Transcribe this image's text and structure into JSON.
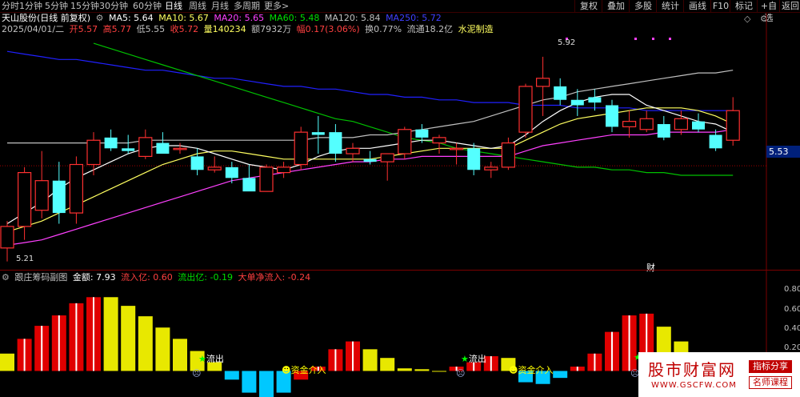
{
  "topbar": {
    "timeframes": [
      {
        "label": "分时",
        "name": "tab-intraday",
        "active": false
      },
      {
        "label": "1分钟",
        "name": "tab-1min",
        "active": false
      },
      {
        "label": "5分钟",
        "name": "tab-5min",
        "active": false
      },
      {
        "label": "15分钟",
        "name": "tab-15min",
        "active": false
      },
      {
        "label": "30分钟",
        "name": "tab-30min",
        "active": false
      },
      {
        "label": "60分钟",
        "name": "tab-60min",
        "active": false
      },
      {
        "label": "日线",
        "name": "tab-daily",
        "active": true
      },
      {
        "label": "周线",
        "name": "tab-weekly",
        "active": false
      },
      {
        "label": "月线",
        "name": "tab-monthly",
        "active": false
      },
      {
        "label": "多周期",
        "name": "tab-multi-period",
        "active": false
      },
      {
        "label": "更多>",
        "name": "tab-more",
        "active": false
      }
    ],
    "right_buttons": [
      {
        "label": "复权",
        "name": "adjust-button"
      },
      {
        "label": "叠加",
        "name": "overlay-button"
      },
      {
        "label": "多股",
        "name": "multi-stock-button"
      },
      {
        "label": "统计",
        "name": "statistics-button"
      },
      {
        "label": "画线",
        "name": "draw-line-button"
      },
      {
        "label": "F10",
        "name": "f10-button"
      },
      {
        "label": "标记",
        "name": "mark-button"
      },
      {
        "label": "+自选",
        "name": "add-watchlist-button"
      },
      {
        "label": "返回",
        "name": "back-button"
      }
    ]
  },
  "stock": {
    "title": "天山股份(日线 前复权)",
    "ma5": "MA5: 5.64",
    "ma10": "MA10: 5.67",
    "ma20": "MA20: 5.65",
    "ma60": "MA60: 5.48",
    "ma120": "MA120: 5.84",
    "ma250": "MA250: 5.72",
    "date": "2025/04/01/二",
    "open": "开5.57",
    "high": "高5.77",
    "low": "低5.55",
    "close": "收5.72",
    "volume": "量140234",
    "amount": "额7932万",
    "change": "幅0.17(3.06%)",
    "turnover": "换0.77%",
    "float_cap": "流通18.2亿",
    "sector": "水泥制造"
  },
  "price_labels": {
    "high_mark": "5.92",
    "low_mark": "5.21",
    "current": "5.53",
    "finance_marker": "财"
  },
  "indicator": {
    "name": "跟庄筹码副图",
    "amount": "金额: 7.93",
    "inflow": "流入亿: 0.60",
    "outflow": "流出亿: -0.19",
    "big_order": "大单净流入: -0.24",
    "axis": [
      "0.80",
      "0.60",
      "0.40",
      "0.20"
    ],
    "labels": {
      "fund_out": "流出",
      "fund_in": "资金介入"
    }
  },
  "watermark": {
    "site": "股市财富网",
    "url": "WWW.GSCFW.COM",
    "tag1": "指标分享",
    "tag2": "名师课程"
  },
  "colors": {
    "up": "#ff3030",
    "down": "#54ffff",
    "ma5": "#ffffff",
    "ma10": "#ffff60",
    "ma20": "#ff40ff",
    "ma60": "#00c000",
    "ma120": "#c0c0c0",
    "ma250": "#2020ff",
    "bar_red": "#e00000",
    "bar_yellow": "#e8e800",
    "bar_cyan": "#00c8ff"
  },
  "chart_data": {
    "type": "candlestick",
    "ylim": [
      5.15,
      6.0
    ],
    "candles": [
      {
        "o": 5.21,
        "h": 5.31,
        "l": 5.16,
        "c": 5.29
      },
      {
        "o": 5.29,
        "h": 5.51,
        "l": 5.24,
        "c": 5.49
      },
      {
        "o": 5.35,
        "h": 5.57,
        "l": 5.32,
        "c": 5.46
      },
      {
        "o": 5.46,
        "h": 5.53,
        "l": 5.3,
        "c": 5.34
      },
      {
        "o": 5.34,
        "h": 5.55,
        "l": 5.3,
        "c": 5.52
      },
      {
        "o": 5.52,
        "h": 5.64,
        "l": 5.48,
        "c": 5.61
      },
      {
        "o": 5.62,
        "h": 5.65,
        "l": 5.57,
        "c": 5.58
      },
      {
        "o": 5.58,
        "h": 5.63,
        "l": 5.56,
        "c": 5.57
      },
      {
        "o": 5.55,
        "h": 5.65,
        "l": 5.54,
        "c": 5.62
      },
      {
        "o": 5.6,
        "h": 5.64,
        "l": 5.57,
        "c": 5.56
      },
      {
        "o": 5.58,
        "h": 5.6,
        "l": 5.56,
        "c": 5.58
      },
      {
        "o": 5.55,
        "h": 5.58,
        "l": 5.48,
        "c": 5.5
      },
      {
        "o": 5.5,
        "h": 5.55,
        "l": 5.49,
        "c": 5.51
      },
      {
        "o": 5.51,
        "h": 5.53,
        "l": 5.45,
        "c": 5.47
      },
      {
        "o": 5.47,
        "h": 5.52,
        "l": 5.43,
        "c": 5.42
      },
      {
        "o": 5.42,
        "h": 5.52,
        "l": 5.42,
        "c": 5.51
      },
      {
        "o": 5.49,
        "h": 5.53,
        "l": 5.47,
        "c": 5.51
      },
      {
        "o": 5.52,
        "h": 5.66,
        "l": 5.5,
        "c": 5.64
      },
      {
        "o": 5.64,
        "h": 5.7,
        "l": 5.56,
        "c": 5.63
      },
      {
        "o": 5.64,
        "h": 5.67,
        "l": 5.53,
        "c": 5.56
      },
      {
        "o": 5.56,
        "h": 5.6,
        "l": 5.53,
        "c": 5.58
      },
      {
        "o": 5.54,
        "h": 5.57,
        "l": 5.52,
        "c": 5.53
      },
      {
        "o": 5.53,
        "h": 5.56,
        "l": 5.46,
        "c": 5.56
      },
      {
        "o": 5.56,
        "h": 5.66,
        "l": 5.54,
        "c": 5.65
      },
      {
        "o": 5.65,
        "h": 5.67,
        "l": 5.6,
        "c": 5.62
      },
      {
        "o": 5.6,
        "h": 5.63,
        "l": 5.56,
        "c": 5.62
      },
      {
        "o": 5.58,
        "h": 5.6,
        "l": 5.52,
        "c": 5.58
      },
      {
        "o": 5.58,
        "h": 5.6,
        "l": 5.48,
        "c": 5.5
      },
      {
        "o": 5.5,
        "h": 5.53,
        "l": 5.47,
        "c": 5.51
      },
      {
        "o": 5.51,
        "h": 5.62,
        "l": 5.5,
        "c": 5.6
      },
      {
        "o": 5.64,
        "h": 5.82,
        "l": 5.62,
        "c": 5.81
      },
      {
        "o": 5.81,
        "h": 5.92,
        "l": 5.7,
        "c": 5.84
      },
      {
        "o": 5.81,
        "h": 5.84,
        "l": 5.74,
        "c": 5.76
      },
      {
        "o": 5.76,
        "h": 5.8,
        "l": 5.7,
        "c": 5.74
      },
      {
        "o": 5.77,
        "h": 5.8,
        "l": 5.72,
        "c": 5.75
      },
      {
        "o": 5.74,
        "h": 5.76,
        "l": 5.64,
        "c": 5.66
      },
      {
        "o": 5.66,
        "h": 5.72,
        "l": 5.62,
        "c": 5.68
      },
      {
        "o": 5.65,
        "h": 5.72,
        "l": 5.64,
        "c": 5.69
      },
      {
        "o": 5.67,
        "h": 5.7,
        "l": 5.61,
        "c": 5.62
      },
      {
        "o": 5.65,
        "h": 5.72,
        "l": 5.63,
        "c": 5.69
      },
      {
        "o": 5.68,
        "h": 5.71,
        "l": 5.64,
        "c": 5.65
      },
      {
        "o": 5.63,
        "h": 5.65,
        "l": 5.57,
        "c": 5.58
      },
      {
        "o": 5.61,
        "h": 5.77,
        "l": 5.59,
        "c": 5.72
      }
    ],
    "ma": {
      "ma5": [
        5.3,
        5.34,
        5.38,
        5.43,
        5.47,
        5.5,
        5.53,
        5.56,
        5.58,
        5.59,
        5.59,
        5.58,
        5.56,
        5.54,
        5.52,
        5.51,
        5.5,
        5.52,
        5.55,
        5.57,
        5.58,
        5.58,
        5.59,
        5.6,
        5.61,
        5.61,
        5.6,
        5.59,
        5.58,
        5.59,
        5.63,
        5.68,
        5.72,
        5.75,
        5.77,
        5.78,
        5.78,
        5.74,
        5.72,
        5.7,
        5.68,
        5.67,
        5.64
      ],
      "ma10": [
        5.27,
        5.29,
        5.31,
        5.34,
        5.37,
        5.4,
        5.43,
        5.46,
        5.49,
        5.52,
        5.54,
        5.56,
        5.57,
        5.57,
        5.56,
        5.55,
        5.54,
        5.54,
        5.54,
        5.54,
        5.54,
        5.54,
        5.55,
        5.56,
        5.57,
        5.58,
        5.58,
        5.58,
        5.58,
        5.58,
        5.61,
        5.64,
        5.67,
        5.69,
        5.7,
        5.71,
        5.72,
        5.73,
        5.73,
        5.73,
        5.72,
        5.7,
        5.67
      ],
      "ma20": [
        5.22,
        5.23,
        5.24,
        5.26,
        5.28,
        5.3,
        5.32,
        5.34,
        5.36,
        5.38,
        5.4,
        5.42,
        5.44,
        5.46,
        5.47,
        5.48,
        5.49,
        5.5,
        5.51,
        5.52,
        5.53,
        5.53,
        5.54,
        5.54,
        5.55,
        5.55,
        5.55,
        5.55,
        5.55,
        5.55,
        5.57,
        5.59,
        5.6,
        5.61,
        5.62,
        5.63,
        5.63,
        5.63,
        5.64,
        5.64,
        5.64,
        5.64,
        5.65
      ],
      "ma60": [
        null,
        null,
        null,
        null,
        null,
        5.97,
        5.95,
        5.93,
        5.91,
        5.89,
        5.87,
        5.85,
        5.83,
        5.81,
        5.79,
        5.77,
        5.75,
        5.73,
        5.71,
        5.69,
        5.68,
        5.66,
        5.64,
        5.62,
        5.61,
        5.6,
        5.58,
        5.57,
        5.56,
        5.55,
        5.54,
        5.53,
        5.52,
        5.51,
        5.51,
        5.5,
        5.5,
        5.49,
        5.49,
        5.48,
        5.48,
        5.48,
        5.48
      ],
      "ma120": [
        5.6,
        5.6,
        5.6,
        5.6,
        5.6,
        5.6,
        5.6,
        5.6,
        5.61,
        5.61,
        5.61,
        5.61,
        5.61,
        5.61,
        5.61,
        5.61,
        5.61,
        5.61,
        5.62,
        5.62,
        5.62,
        5.63,
        5.63,
        5.64,
        5.65,
        5.66,
        5.67,
        5.68,
        5.7,
        5.72,
        5.74,
        5.76,
        5.77,
        5.79,
        5.8,
        5.81,
        5.82,
        5.83,
        5.84,
        5.85,
        5.86,
        5.86,
        5.87
      ],
      "ma250": [
        5.94,
        5.93,
        5.92,
        5.91,
        5.91,
        5.9,
        5.89,
        5.88,
        5.87,
        5.87,
        5.86,
        5.85,
        5.84,
        5.84,
        5.83,
        5.82,
        5.81,
        5.81,
        5.8,
        5.8,
        5.79,
        5.78,
        5.78,
        5.77,
        5.77,
        5.76,
        5.76,
        5.75,
        5.75,
        5.75,
        5.74,
        5.74,
        5.74,
        5.73,
        5.73,
        5.73,
        5.73,
        5.72,
        5.72,
        5.72,
        5.72,
        5.72,
        5.72
      ]
    },
    "sub_ylim": [
      -0.3,
      1.0
    ],
    "sub_bars": [
      0.2,
      0.37,
      0.52,
      0.64,
      0.78,
      0.85,
      0.85,
      0.75,
      0.63,
      0.5,
      0.37,
      0.23,
      0.1,
      -0.1,
      -0.25,
      -0.3,
      -0.25,
      -0.1,
      0.05,
      0.25,
      0.34,
      0.25,
      0.15,
      0.03,
      0.02,
      0.0,
      0.05,
      0.1,
      0.17,
      0.15,
      -0.13,
      -0.15,
      -0.08,
      0.05,
      0.2,
      0.45,
      0.64,
      0.66,
      0.51,
      0.34,
      0.12,
      0.05,
      0.02
    ]
  }
}
